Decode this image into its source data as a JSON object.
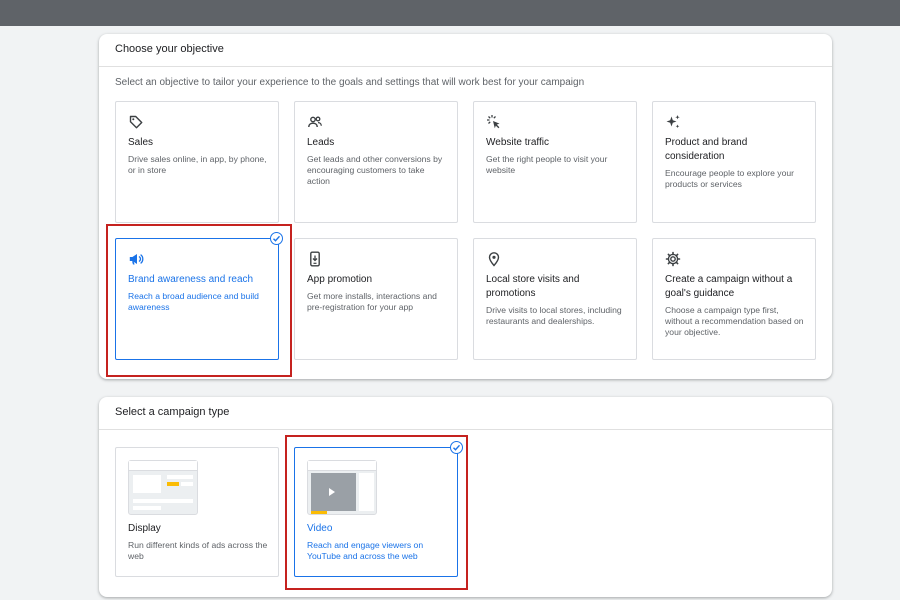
{
  "objective_panel": {
    "title": "Choose your objective",
    "subtitle": "Select an objective to tailor your experience to the goals and settings that will work best for your campaign",
    "cards": [
      {
        "title": "Sales",
        "desc": "Drive sales online, in app, by phone, or in store",
        "icon": "tag-icon"
      },
      {
        "title": "Leads",
        "desc": "Get leads and other conversions by encouraging customers to take action",
        "icon": "people-icon"
      },
      {
        "title": "Website traffic",
        "desc": "Get the right people to visit your website",
        "icon": "cursor-click-icon"
      },
      {
        "title": "Product and brand consideration",
        "desc": "Encourage people to explore your products or services",
        "icon": "sparkle-icon"
      },
      {
        "title": "Brand awareness and reach",
        "desc": "Reach a broad audience and build awareness",
        "icon": "megaphone-icon",
        "selected": true
      },
      {
        "title": "App promotion",
        "desc": "Get more installs, interactions and pre-registration for your app",
        "icon": "phone-icon"
      },
      {
        "title": "Local store visits and promotions",
        "desc": "Drive visits to local stores, including restaurants and dealerships.",
        "icon": "location-pin-icon"
      },
      {
        "title": "Create a campaign without a goal's guidance",
        "desc": "Choose a campaign type first, without a recommendation based on your objective.",
        "icon": "gear-icon"
      }
    ]
  },
  "campaign_panel": {
    "title": "Select a campaign type",
    "cards": [
      {
        "title": "Display",
        "desc": "Run different kinds of ads across the web",
        "icon": "display-ad-thumbnail-icon"
      },
      {
        "title": "Video",
        "desc": "Reach and engage viewers on YouTube and across the web",
        "icon": "video-ad-thumbnail-icon",
        "selected": true
      }
    ]
  },
  "colors": {
    "accent": "#1a73e8",
    "highlight": "#c5221f",
    "accent_yellow": "#fbbc04"
  }
}
